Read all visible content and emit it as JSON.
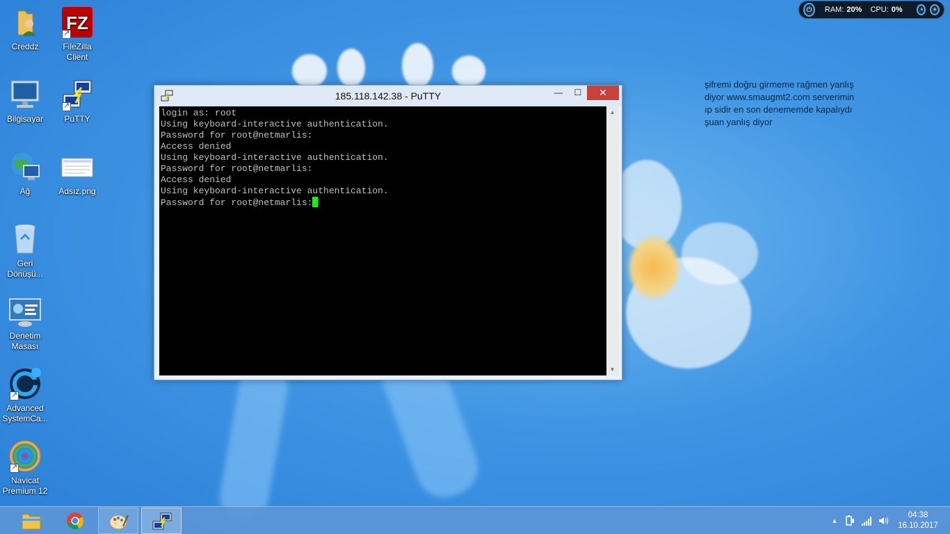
{
  "desktop": {
    "icons": [
      {
        "label": "Creddz",
        "icon": "user-folder-icon"
      },
      {
        "label": "FileZilla Client",
        "icon": "filezilla-icon"
      },
      {
        "label": "Bilgisayar",
        "icon": "computer-icon"
      },
      {
        "label": "PuTTY",
        "icon": "putty-icon"
      },
      {
        "label": "Ağ",
        "icon": "network-icon"
      },
      {
        "label": "Adsız.png",
        "icon": "image-file-icon"
      },
      {
        "label": "Geri Dönüşü...",
        "icon": "recycle-bin-icon"
      },
      {
        "label": "Denetim Masası",
        "icon": "control-panel-icon"
      },
      {
        "label": "Advanced SystemCa...",
        "icon": "advanced-systemcare-icon"
      },
      {
        "label": "Navicat Premium 12",
        "icon": "navicat-icon"
      }
    ],
    "note": "şifremi doğru girmeme rağmen yanlış diyor www.smaugmt2.com serverimin ıp sidir en son denememde kapalıydı şuan yanlış diyor"
  },
  "gadget": {
    "ram_label": "RAM:",
    "ram_value": "20%",
    "cpu_label": "CPU:",
    "cpu_value": "0%"
  },
  "putty": {
    "title": "185.118.142.38 - PuTTY",
    "lines": [
      "login as: root",
      "Using keyboard-interactive authentication.",
      "Password for root@netmarlis:",
      "Access denied",
      "Using keyboard-interactive authentication.",
      "Password for root@netmarlis:",
      "Access denied",
      "Using keyboard-interactive authentication.",
      "Password for root@netmarlis:"
    ],
    "cursor_color": "#00ff00",
    "controls": {
      "minimize": "—",
      "maximize": "☐",
      "close": "✕"
    }
  },
  "taskbar": {
    "apps": [
      {
        "name": "File Explorer",
        "icon": "file-explorer-icon"
      },
      {
        "name": "Google Chrome",
        "icon": "chrome-icon"
      },
      {
        "name": "Paint",
        "icon": "paint-icon"
      },
      {
        "name": "PuTTY",
        "icon": "putty-icon"
      }
    ],
    "tray": {
      "show_hidden": "▲",
      "time": "04:38",
      "date": "16.10.2017"
    }
  },
  "colors": {
    "accent": "#2a7fd8",
    "close_button": "#c7433a",
    "terminal_bg": "#000000",
    "terminal_text": "#c0c0c0"
  }
}
